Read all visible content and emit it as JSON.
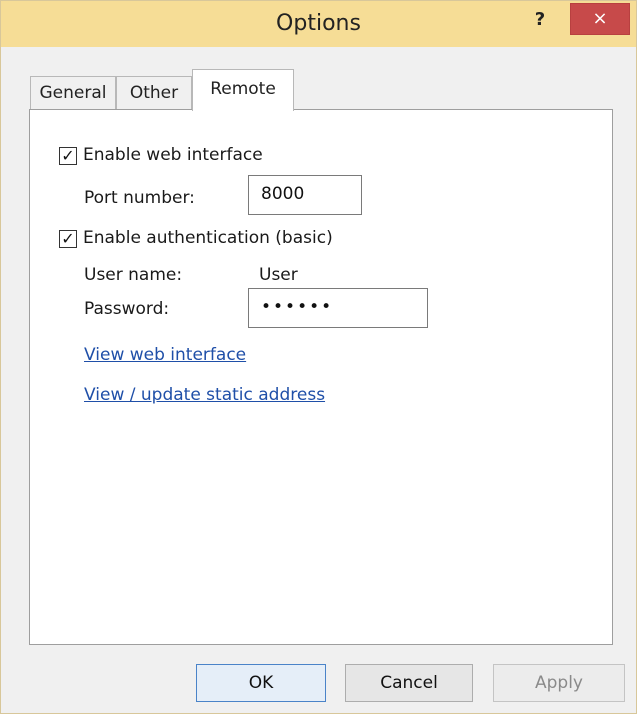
{
  "window": {
    "title": "Options",
    "help_label": "?",
    "close_label": "×"
  },
  "tabs": [
    {
      "label": "General",
      "active": false
    },
    {
      "label": "Other",
      "active": false
    },
    {
      "label": "Remote",
      "active": true
    }
  ],
  "remote": {
    "enable_web": {
      "label": "Enable web interface",
      "checked": true,
      "mark": "✓"
    },
    "port": {
      "label": "Port number:",
      "value": "8000"
    },
    "enable_auth": {
      "label": "Enable authentication (basic)",
      "checked": true,
      "mark": "✓"
    },
    "username": {
      "label": "User name:",
      "value": "User"
    },
    "password": {
      "label": "Password:",
      "value": "••••••"
    },
    "links": {
      "view_web": "View web interface",
      "static_address": "View / update static address"
    }
  },
  "buttons": {
    "ok": "OK",
    "cancel": "Cancel",
    "apply": "Apply"
  },
  "colors": {
    "titlebar": "#f6dd96",
    "close": "#c74a4a",
    "link": "#1f4fa8"
  },
  "icons": {
    "help": "help-icon",
    "close": "close-icon",
    "checkbox": "checkmark-icon"
  }
}
